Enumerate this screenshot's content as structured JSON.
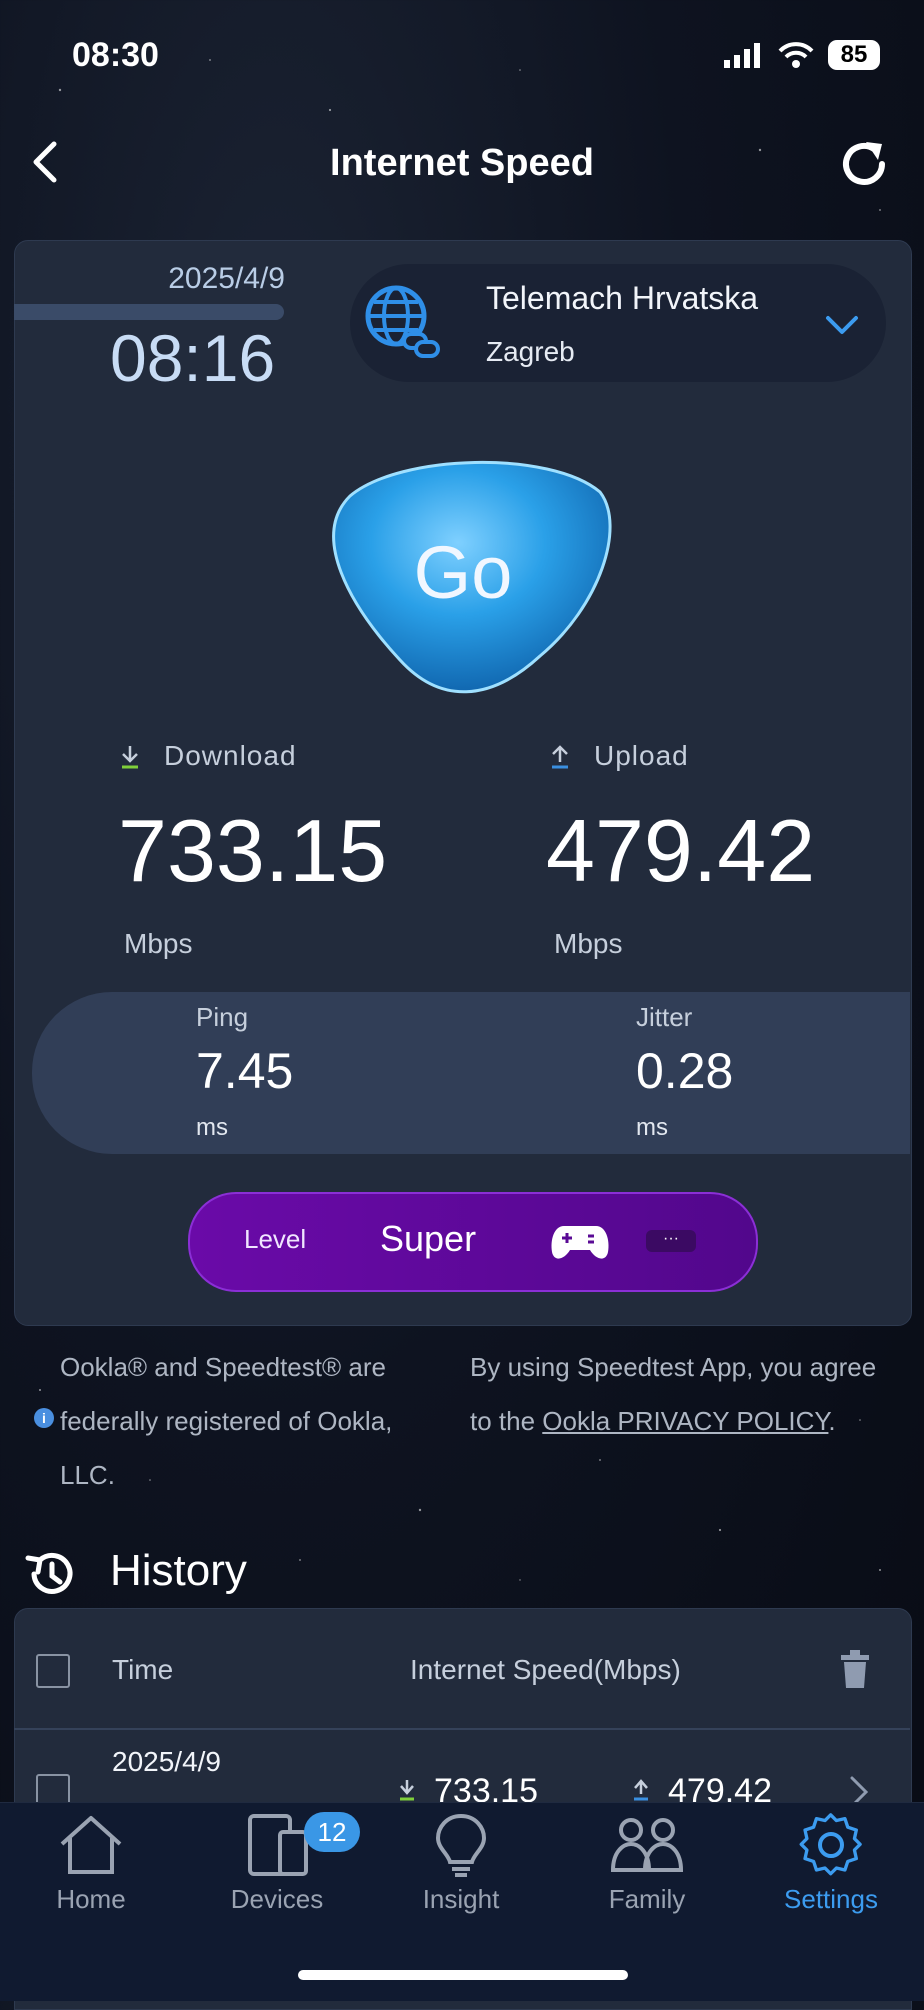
{
  "status_bar": {
    "time": "08:30",
    "battery": "85"
  },
  "header": {
    "title": "Internet Speed"
  },
  "test": {
    "date": "2025/4/9",
    "time": "08:16"
  },
  "server": {
    "provider": "Telemach Hrvatska",
    "city": "Zagreb"
  },
  "go_label": "Go",
  "download": {
    "label": "Download",
    "value": "733.15",
    "unit": "Mbps"
  },
  "upload": {
    "label": "Upload",
    "value": "479.42",
    "unit": "Mbps"
  },
  "ping": {
    "label": "Ping",
    "value": "7.45",
    "unit": "ms"
  },
  "jitter": {
    "label": "Jitter",
    "value": "0.28",
    "unit": "ms"
  },
  "level": {
    "label": "Level",
    "value": "Super",
    "more": "···"
  },
  "legal": {
    "left": "Ookla® and Speedtest® are federally registered of Ookla, LLC.",
    "right_prefix": "By using Speedtest App, you agree to the ",
    "right_link": "Ookla PRIVACY POLICY",
    "right_suffix": "."
  },
  "history": {
    "title": "History",
    "col_time": "Time",
    "col_speed": "Internet Speed(Mbps)",
    "rows": [
      {
        "date": "2025/4/9",
        "download": "733.15",
        "upload": "479.42"
      }
    ]
  },
  "tabs": [
    {
      "label": "Home",
      "icon": "home-icon"
    },
    {
      "label": "Devices",
      "icon": "devices-icon",
      "badge": "12"
    },
    {
      "label": "Insight",
      "icon": "lightbulb-icon"
    },
    {
      "label": "Family",
      "icon": "family-icon"
    },
    {
      "label": "Settings",
      "icon": "gear-icon",
      "active": true
    }
  ],
  "colors": {
    "accent": "#3c9cf0",
    "level_purple": "#6a0aa8",
    "download_green": "#7fcf3a",
    "upload_blue": "#3a8fe0"
  }
}
